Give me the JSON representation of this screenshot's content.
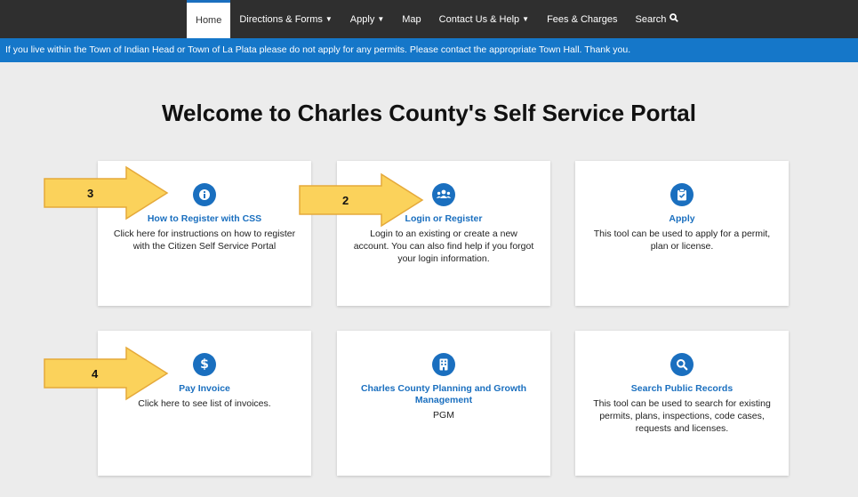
{
  "nav": {
    "items": [
      {
        "label": "Home",
        "active": true,
        "caret": false,
        "icon": ""
      },
      {
        "label": "Directions & Forms",
        "active": false,
        "caret": true,
        "icon": ""
      },
      {
        "label": "Apply",
        "active": false,
        "caret": true,
        "icon": ""
      },
      {
        "label": "Map",
        "active": false,
        "caret": false,
        "icon": ""
      },
      {
        "label": "Contact Us & Help",
        "active": false,
        "caret": true,
        "icon": ""
      },
      {
        "label": "Fees & Charges",
        "active": false,
        "caret": false,
        "icon": ""
      },
      {
        "label": "Search",
        "active": false,
        "caret": false,
        "icon": "search-icon"
      }
    ]
  },
  "banner": {
    "text": "If you live within the Town of Indian Head or Town of La Plata please do not apply for any permits.  Please contact the appropriate Town Hall. Thank you."
  },
  "page": {
    "title": "Welcome to Charles County's Self Service Portal"
  },
  "cards": [
    {
      "title": "How to Register with CSS",
      "desc": "Click here for instructions on how to register with the Citizen Self Service Portal",
      "icon": "info-icon"
    },
    {
      "title": "Login or Register",
      "desc": "Login to an existing or create a new account. You can also find help if you forgot your login information.",
      "icon": "users-icon"
    },
    {
      "title": "Apply",
      "desc": "This tool can be used to apply for a permit, plan or license.",
      "icon": "clipboard-check-icon"
    },
    {
      "title": "Pay Invoice",
      "desc": "Click here to see list of invoices.",
      "icon": "dollar-icon"
    },
    {
      "title": "Charles County Planning and Growth Management",
      "desc": "PGM",
      "icon": "building-icon"
    },
    {
      "title": "Search Public Records",
      "desc": "This tool can be used to search for existing permits, plans, inspections, code cases, requests and licenses.",
      "icon": "search-icon"
    }
  ],
  "annotations": [
    {
      "number": "3"
    },
    {
      "number": "2"
    },
    {
      "number": "4"
    }
  ],
  "colors": {
    "nav_bg": "#2f2f2f",
    "banner_bg": "#1577c9",
    "accent": "#1a6fbf",
    "arrow_fill": "#fbd25b",
    "arrow_stroke": "#e5a93a",
    "page_bg": "#ececec"
  }
}
